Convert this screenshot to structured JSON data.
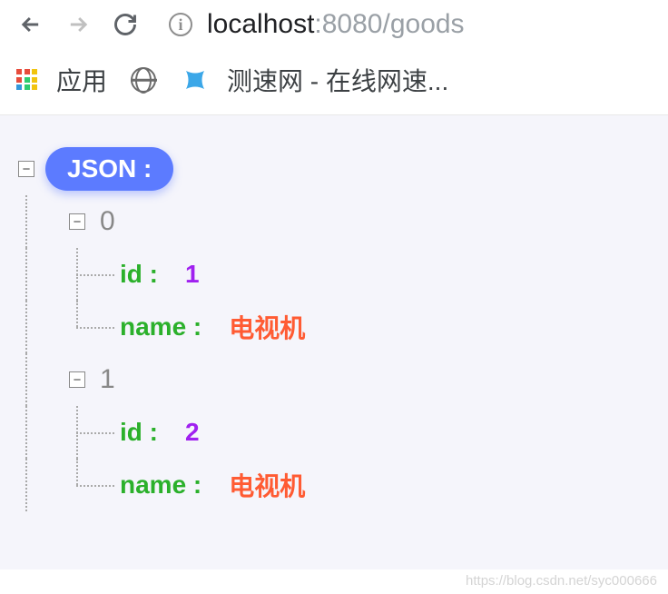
{
  "url": {
    "host": "localhost",
    "port": ":8080",
    "path": "/goods"
  },
  "bookmarks": {
    "apps_label": "应用",
    "speed_label": "测速网 - 在线网速..."
  },
  "json_label": "JSON :",
  "tree": [
    {
      "index": "0",
      "id_key": "id :",
      "id_val": "1",
      "name_key": "name :",
      "name_val": "电视机"
    },
    {
      "index": "1",
      "id_key": "id :",
      "id_val": "2",
      "name_key": "name :",
      "name_val": "电视机"
    }
  ],
  "watermark": "https://blog.csdn.net/syc000666"
}
